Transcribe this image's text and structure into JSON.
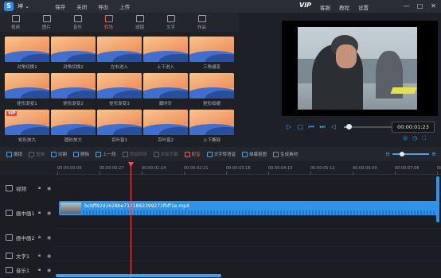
{
  "titlebar": {
    "logo": "S",
    "user": "坤 ⌄",
    "menu": [
      "保存",
      "关闭",
      "导出",
      "上传"
    ],
    "vip": "VIP",
    "right_menu": [
      "客服",
      "教程",
      "设置"
    ],
    "controls": [
      "—",
      "□",
      "✕"
    ]
  },
  "tabs": [
    {
      "label": "视频",
      "icon": "video-icon"
    },
    {
      "label": "图片",
      "icon": "image-icon"
    },
    {
      "label": "音乐",
      "icon": "music-icon"
    },
    {
      "label": "转场",
      "icon": "transition-icon",
      "active": true
    },
    {
      "label": "滤镜",
      "icon": "filter-icon"
    },
    {
      "label": "文字",
      "icon": "text-icon"
    },
    {
      "label": "作品",
      "icon": "works-icon"
    }
  ],
  "effects": [
    {
      "label": "对角切换1",
      "vip": false
    },
    {
      "label": "对角切换2",
      "vip": false
    },
    {
      "label": "左右进入",
      "vip": false
    },
    {
      "label": "上下进入",
      "vip": false
    },
    {
      "label": "三角褪变",
      "vip": false
    },
    {
      "label": "矩形渐变1",
      "vip": false
    },
    {
      "label": "矩形渐变2",
      "vip": false
    },
    {
      "label": "矩形渐变3",
      "vip": false
    },
    {
      "label": "顺时针",
      "vip": false
    },
    {
      "label": "矩形收缩",
      "vip": false
    },
    {
      "label": "矩形放大",
      "vip": true
    },
    {
      "label": "圆形放大",
      "vip": false
    },
    {
      "label": "百叶窗1",
      "vip": false
    },
    {
      "label": "百叶窗2",
      "vip": false
    },
    {
      "label": "上下撕除",
      "vip": false
    }
  ],
  "vip_badge": "VIP",
  "player": {
    "timecode": "00:00:01:23",
    "progress": 0.1
  },
  "toolbar": [
    {
      "label": "撤销",
      "state": "normal"
    },
    {
      "label": "重做",
      "state": "dim"
    },
    {
      "label": "切割",
      "state": "normal"
    },
    {
      "label": "删除",
      "state": "normal"
    },
    {
      "label": "上一段",
      "state": "normal"
    },
    {
      "label": "添加转场",
      "state": "dim"
    },
    {
      "label": "添加字幕",
      "state": "dim"
    },
    {
      "label": "配音",
      "state": "red"
    },
    {
      "label": "文字转语音",
      "state": "normal"
    },
    {
      "label": "绿幕抠图",
      "state": "normal"
    },
    {
      "label": "生成素材",
      "state": "normal"
    }
  ],
  "zoom_level": 0.25,
  "ruler": [
    "00:00:00:00",
    "00:00:00:27",
    "00:00:01:24",
    "00:00:02:21",
    "00:00:03:18",
    "00:00:04:15",
    "00:00:05:12",
    "00:00:06:09",
    "00:00:07:06",
    "00:00:08:03"
  ],
  "tracks": [
    {
      "label": "视频",
      "icon": "video-track-icon"
    },
    {
      "label": "画中画1",
      "icon": "pip-track-icon"
    },
    {
      "label": "画中画2",
      "icon": "pip-track-icon"
    },
    {
      "label": "文字1",
      "icon": "text-track-icon"
    },
    {
      "label": "音乐1",
      "icon": "music-track-icon"
    }
  ],
  "clip": {
    "name": "bcbff82d2628be7121883399271fbff1e.mp4"
  }
}
